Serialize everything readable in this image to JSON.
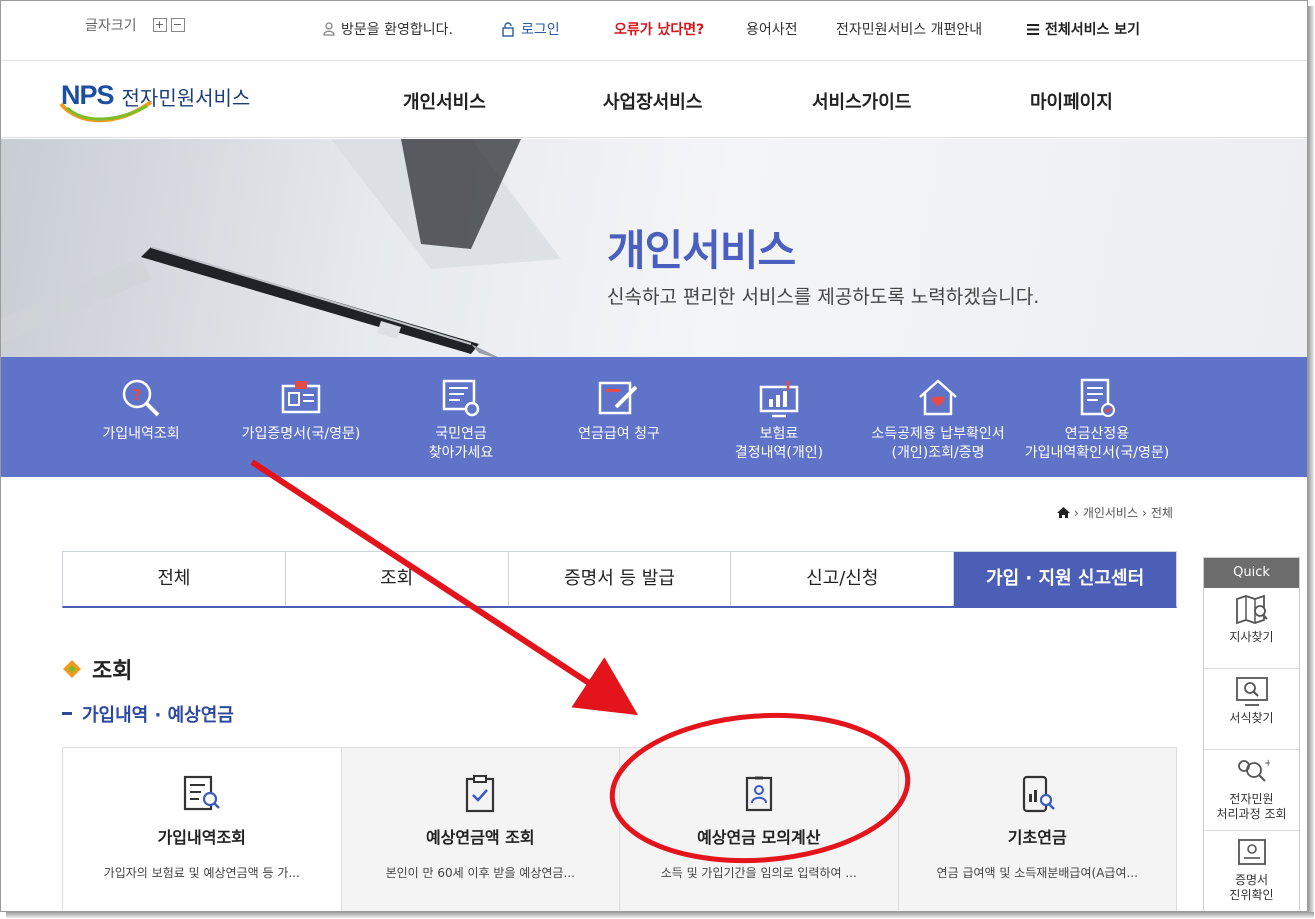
{
  "util": {
    "fontsize_label": "글자크기",
    "plus": "+",
    "minus": "−",
    "welcome": "방문을 환영합니다.",
    "login": "로그인",
    "error_report": "오류가 났다면?",
    "glossary": "용어사전",
    "renewal_notice": "전자민원서비스 개편안내",
    "all_services": "전체서비스 보기"
  },
  "header": {
    "logo_nps": "NPS",
    "logo_text": "전자민원서비스",
    "gnb": [
      "개인서비스",
      "사업장서비스",
      "서비스가이드",
      "마이페이지"
    ]
  },
  "banner": {
    "title": "개인서비스",
    "subtitle": "신속하고 편리한 서비스를 제공하도록 노력하겠습니다."
  },
  "quickstrip": [
    {
      "label": "가입내역조회",
      "icon": "search-question-icon"
    },
    {
      "label": "가입증명서(국/영문)",
      "icon": "id-card-icon"
    },
    {
      "label": "국민연금\n찾아가세요",
      "icon": "document-search-icon"
    },
    {
      "label": "연금급여 청구",
      "icon": "edit-document-icon"
    },
    {
      "label": "보험료\n결정내역(개인)",
      "icon": "monitor-chart-icon"
    },
    {
      "label": "소득공제용 납부확인서\n(개인)조회/증명",
      "icon": "house-heart-icon"
    },
    {
      "label": "연금산정용\n가입내역확인서(국/영문)",
      "icon": "document-check-icon"
    }
  ],
  "breadcrumb": {
    "home": "home-icon",
    "level1": "개인서비스",
    "level2": "전체"
  },
  "tabs": [
    "전체",
    "조회",
    "증명서 등 발급",
    "신고/신청",
    "가입 · 지원 신고센터"
  ],
  "section": {
    "title": "조회",
    "subtitle": "가입내역 · 예상연금"
  },
  "cards": [
    {
      "title": "가입내역조회",
      "desc": "가입자의 보험료 및 예상연금액 등 가...",
      "icon": "list-search-icon"
    },
    {
      "title": "예상연금액 조회",
      "desc": "본인이 만 60세 이후 받을 예상연금...",
      "icon": "clipboard-check-icon"
    },
    {
      "title": "예상연금 모의계산",
      "desc": "소득 및 가입기간을 임의로 입력하여 ...",
      "icon": "id-badge-icon"
    },
    {
      "title": "기초연금",
      "desc": "연금 급여액 및 소득재분배급여(A급여...",
      "icon": "mobile-chart-icon"
    }
  ],
  "quickpanel": {
    "title": "Quick",
    "items": [
      {
        "label": "지사찾기",
        "icon": "map-search-icon"
      },
      {
        "label": "서식찾기",
        "icon": "monitor-search-icon"
      },
      {
        "label": "전자민원\n처리과정 조회",
        "icon": "people-search-icon"
      },
      {
        "label": "증명서\n진위확인",
        "icon": "certificate-icon"
      }
    ]
  },
  "colors": {
    "accent": "#5f73c9",
    "tab_active": "#4c5fb7",
    "annotation": "#e3141b"
  }
}
